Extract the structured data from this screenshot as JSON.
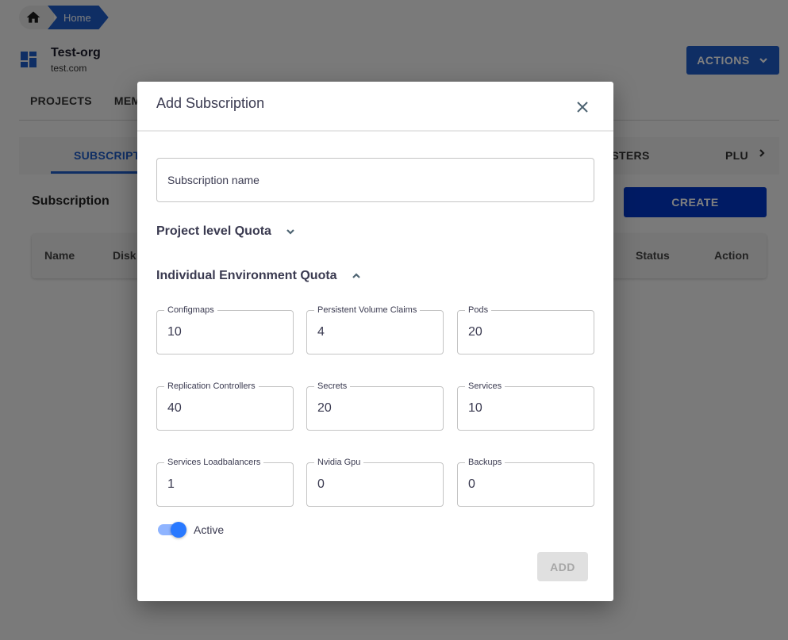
{
  "breadcrumb": {
    "home_icon": "home-icon",
    "current": "Home"
  },
  "org": {
    "icon": "dashboard-icon",
    "name": "Test-org",
    "domain": "test.com"
  },
  "header": {
    "actions_label": "ACTIONS",
    "actions_icon": "chevron-down-icon"
  },
  "main_tabs": [
    {
      "label": "PROJECTS"
    },
    {
      "label": "MEM"
    }
  ],
  "sub_tabs": {
    "active": "SUBSCRIPTI",
    "clusters": "USTERS",
    "plu": "PLU",
    "scroll_icon": "chevron-right-icon"
  },
  "subscription": {
    "title": "Subscription",
    "create_label": "CREATE",
    "columns": [
      "Name",
      "Disk",
      "Status",
      "Action"
    ]
  },
  "modal": {
    "title": "Add Subscription",
    "close_icon": "close-icon",
    "name_placeholder": "Subscription name",
    "name_value": "",
    "project_quota_label": "Project level Quota",
    "project_quota_expanded": false,
    "env_quota_label": "Individual Environment Quota",
    "env_quota_expanded": true,
    "fields": [
      {
        "label": "Configmaps",
        "value": "10"
      },
      {
        "label": "Persistent Volume Claims",
        "value": "4"
      },
      {
        "label": "Pods",
        "value": "20"
      },
      {
        "label": "Replication Controllers",
        "value": "40"
      },
      {
        "label": "Secrets",
        "value": "20"
      },
      {
        "label": "Services",
        "value": "10"
      },
      {
        "label": "Services Loadbalancers",
        "value": "1"
      },
      {
        "label": "Nvidia Gpu",
        "value": "0"
      },
      {
        "label": "Backups",
        "value": "0"
      }
    ],
    "active_label": "Active",
    "active": true,
    "add_label": "ADD"
  },
  "colors": {
    "primary": "#1f5cc9",
    "create": "#0037c8",
    "toggle_on": "#2979ff",
    "disabled_bg": "#e0e0e0"
  }
}
